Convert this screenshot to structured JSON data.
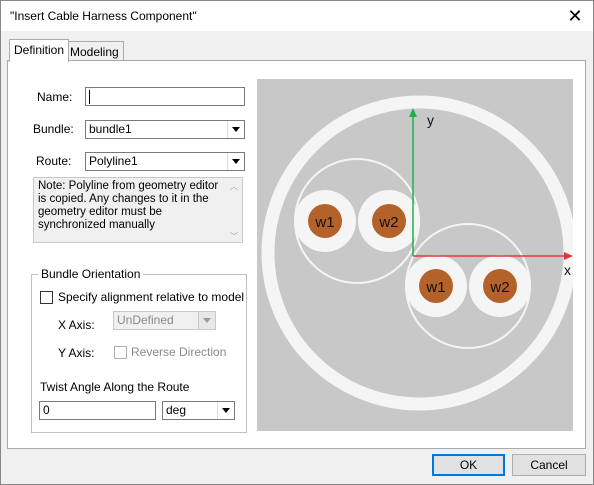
{
  "window": {
    "title": "\"Insert Cable Harness Component\"",
    "close_glyph": "✕"
  },
  "tabs": [
    {
      "label": "Definition"
    },
    {
      "label": "Modeling"
    }
  ],
  "form": {
    "name_label": "Name:",
    "name_value": "",
    "bundle_label": "Bundle:",
    "bundle_value": "bundle1",
    "route_label": "Route:",
    "route_value": "Polyline1",
    "note_text": "Note: Polyline from geometry editor is copied. Any changes to it in the geometry editor must be synchronized manually"
  },
  "orientation": {
    "group_title": "Bundle Orientation",
    "specify_label": "Specify alignment relative to model",
    "specify_checked": false,
    "x_axis_label": "X Axis:",
    "x_axis_value": "UnDefined",
    "y_axis_label": "Y Axis:",
    "reverse_label": "Reverse Direction",
    "twist_label": "Twist Angle Along the Route",
    "twist_value": "0",
    "twist_unit": "deg"
  },
  "preview": {
    "x_axis_label": "x",
    "y_axis_label": "y",
    "wires_group1": [
      "w1",
      "w2"
    ],
    "wires_group2": [
      "w1",
      "w2"
    ],
    "colors": {
      "background": "#c8c8c8",
      "sheath": "#f5f5f5",
      "wire": "#b5612a",
      "x_axis": "#e0383e",
      "y_axis": "#22b04b"
    }
  },
  "buttons": {
    "ok": "OK",
    "cancel": "Cancel"
  }
}
